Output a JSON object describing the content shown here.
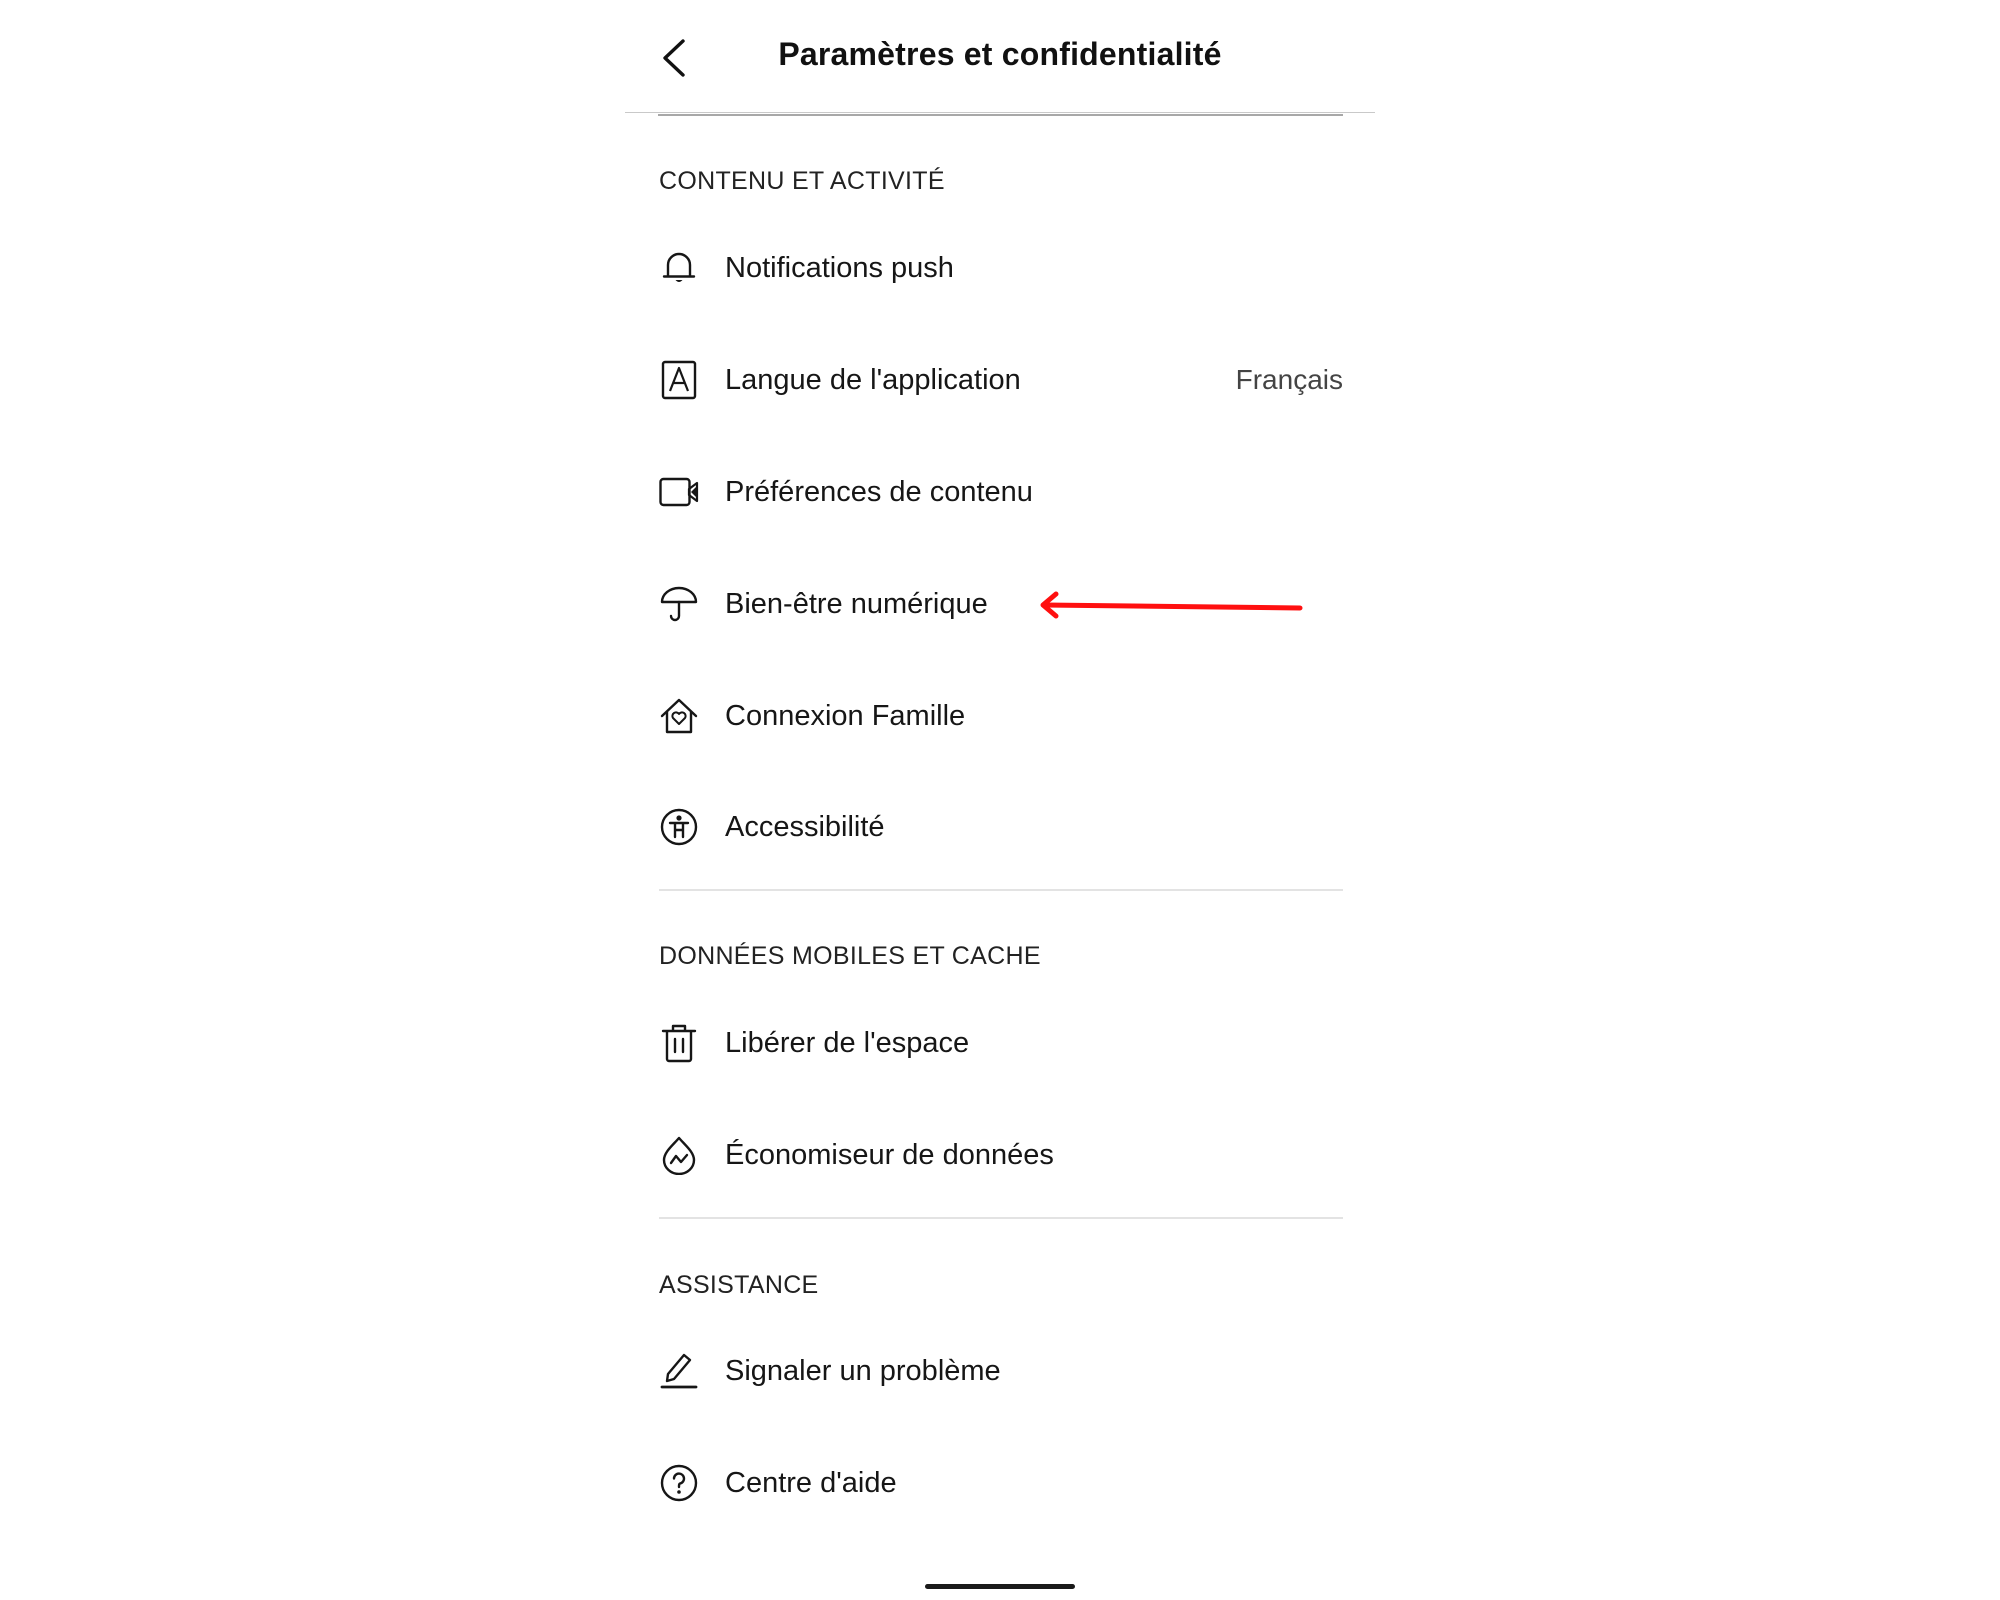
{
  "header": {
    "title": "Paramètres et confidentialité",
    "back_icon": "chevron-left-icon"
  },
  "sections": [
    {
      "title": "CONTENU ET ACTIVITÉ",
      "items": [
        {
          "label": "Notifications push",
          "icon": "bell-icon",
          "value": ""
        },
        {
          "label": "Langue de l'application",
          "icon": "language-icon",
          "value": "Français"
        },
        {
          "label": "Préférences de contenu",
          "icon": "video-camera-icon",
          "value": ""
        },
        {
          "label": "Bien-être numérique",
          "icon": "umbrella-icon",
          "value": ""
        },
        {
          "label": "Connexion Famille",
          "icon": "family-house-icon",
          "value": ""
        },
        {
          "label": "Accessibilité",
          "icon": "accessibility-icon",
          "value": ""
        }
      ]
    },
    {
      "title": "DONNÉES MOBILES ET CACHE",
      "items": [
        {
          "label": "Libérer de l'espace",
          "icon": "trash-icon",
          "value": ""
        },
        {
          "label": "Économiseur de données",
          "icon": "data-saver-icon",
          "value": ""
        }
      ]
    },
    {
      "title": "ASSISTANCE",
      "items": [
        {
          "label": "Signaler un problème",
          "icon": "pencil-icon",
          "value": ""
        },
        {
          "label": "Centre d'aide",
          "icon": "help-circle-icon",
          "value": ""
        }
      ]
    }
  ],
  "annotation": {
    "type": "arrow",
    "color": "#ff1010",
    "points_to": "Bien-être numérique"
  }
}
